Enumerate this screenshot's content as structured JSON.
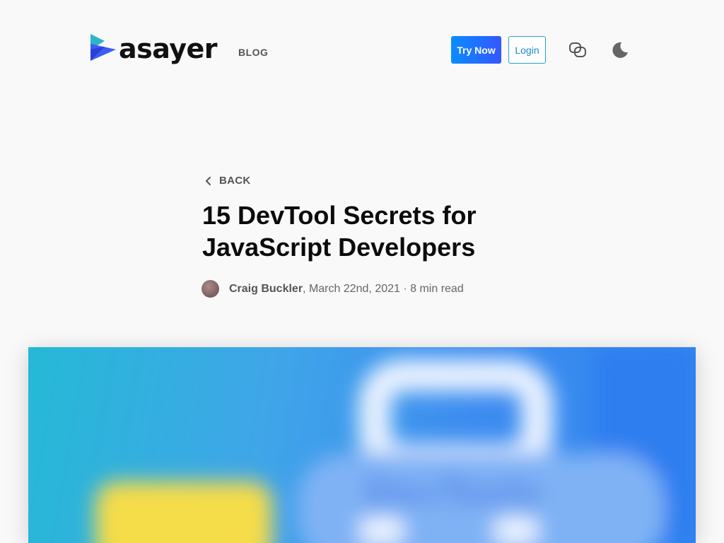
{
  "header": {
    "brand": "asayer",
    "brand_tag": "BLOG",
    "try_label": "Try Now",
    "login_label": "Login"
  },
  "icons": {
    "chat": "chat-bubbles-icon",
    "theme": "moon-icon",
    "back": "chevron-left-icon"
  },
  "article": {
    "back_label": "BACK",
    "title": "15 DevTool Secrets for JavaScript Developers",
    "author": "Craig Buckler",
    "date_read": ", March 22nd, 2021 · 8 min read"
  },
  "hero": {
    "text": "DevTools"
  },
  "colors": {
    "accent": "#0a8cff",
    "accent_end": "#3457ff",
    "login_border": "#21a3c4",
    "background": "#f9f9f9"
  }
}
